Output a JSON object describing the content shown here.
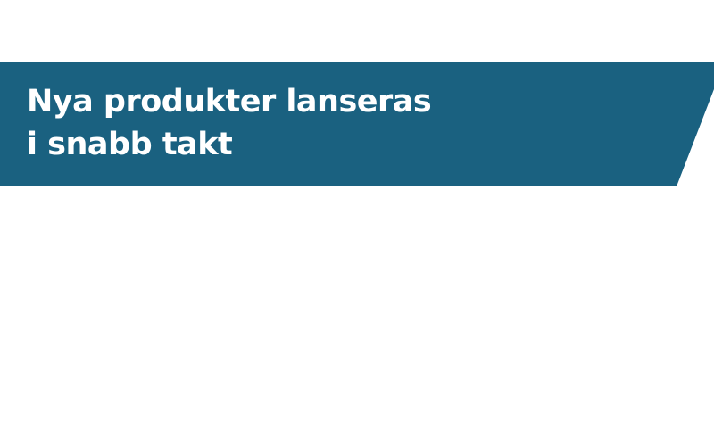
{
  "banner": {
    "title_line_1": "Nya produkter lanseras",
    "title_line_2": "i snabb takt",
    "background_color": "#1a6180",
    "text_color": "#ffffff"
  }
}
